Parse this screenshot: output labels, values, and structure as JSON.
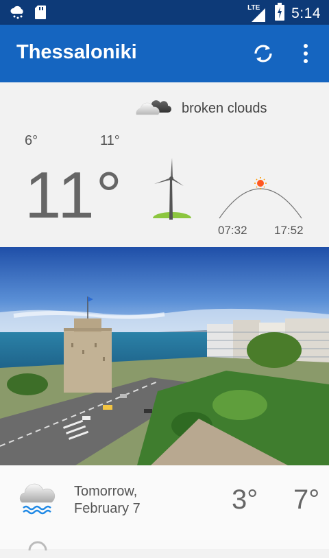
{
  "status_bar": {
    "time": "5:14",
    "network": "LTE",
    "icons": [
      "weather-snow-icon",
      "sd-card-icon",
      "signal-icon",
      "battery-charging-icon"
    ]
  },
  "app_bar": {
    "title": "Thessaloniki",
    "icons": [
      "refresh-icon",
      "more-vert-icon"
    ],
    "color": "#1565c0"
  },
  "current": {
    "condition": "broken clouds",
    "temp_min": "6°",
    "temp_max": "11°",
    "temperature": "11°",
    "sunrise": "07:32",
    "sunset": "17:52",
    "icons": [
      "broken-clouds-icon",
      "wind-turbine-icon",
      "sun-arc-icon"
    ]
  },
  "forecast": [
    {
      "day": "Tomorrow,",
      "date": "February 7",
      "min": "3°",
      "max": "7°",
      "icon": "rain-cloud-icon"
    }
  ]
}
